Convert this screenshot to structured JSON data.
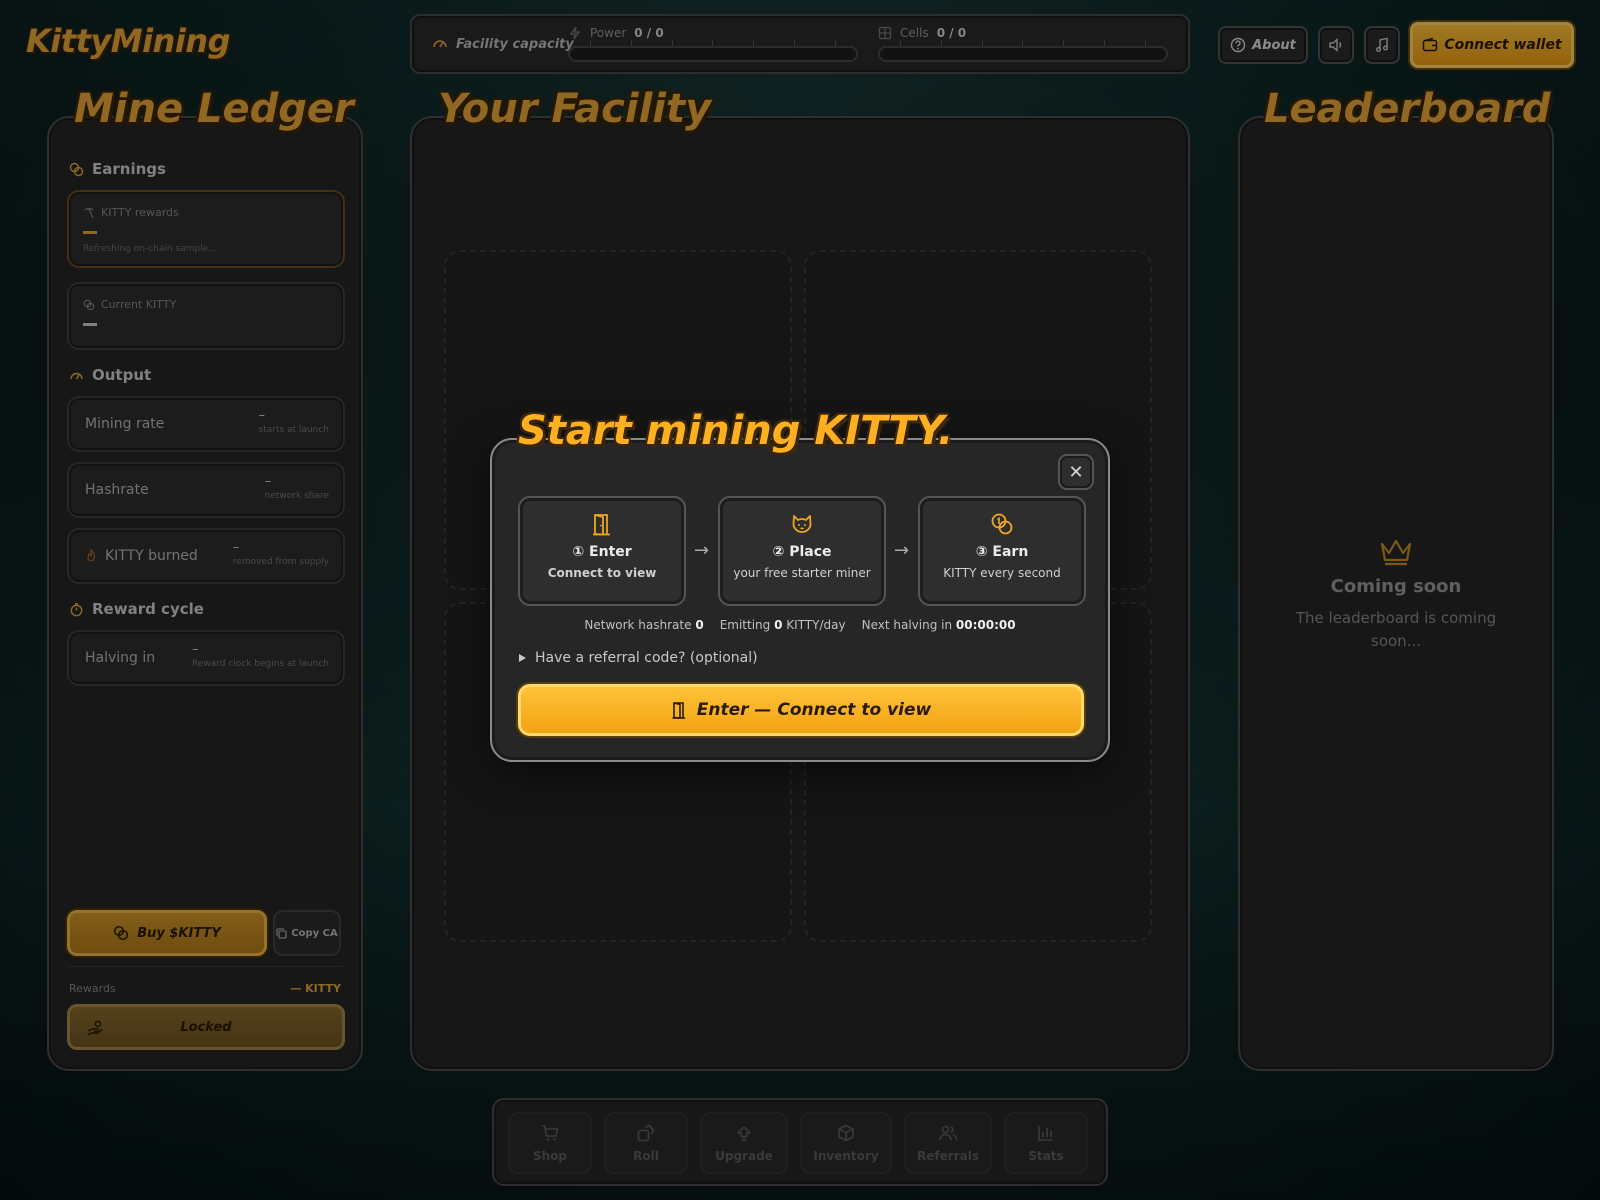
{
  "app": {
    "logo": "KittyMining"
  },
  "capacity": {
    "label": "Facility capacity",
    "power_label": "Power",
    "power_value": "0 / 0",
    "power_fraction": 0,
    "cells_label": "Cells",
    "cells_value": "0 / 0",
    "cells_fraction": 0
  },
  "header": {
    "about_label": "About",
    "connect_wallet_label": "Connect wallet"
  },
  "ledger": {
    "title": "Mine Ledger",
    "earnings_head": "Earnings",
    "kitty_rewards_label": "KITTY rewards",
    "kitty_rewards_sub": "Refreshing on-chain sample...",
    "current_kitty_label": "Current KITTY",
    "output_head": "Output",
    "mining_rate_label": "Mining rate",
    "mining_rate_value": "–",
    "mining_rate_note": "starts at launch",
    "hashrate_label": "Hashrate",
    "hashrate_value": "–",
    "hashrate_note": "network share",
    "burned_label": "KITTY burned",
    "burned_value": "–",
    "burned_note": "removed from supply",
    "reward_cycle_head": "Reward cycle",
    "halving_label": "Halving in",
    "halving_value": "–",
    "halving_note": "Reward clock begins at launch",
    "buy_label": "Buy $KITTY",
    "copy_label": "Copy CA",
    "rewards_label": "Rewards",
    "rewards_value": "— KITTY",
    "locked_label": "Locked"
  },
  "facility": {
    "title": "Your Facility"
  },
  "leaderboard": {
    "title": "Leaderboard",
    "soon_title": "Coming soon",
    "soon_text": "The leaderboard is coming soon..."
  },
  "modal": {
    "title": "Start mining KITTY.",
    "close_label": "✕",
    "steps": [
      {
        "heading": "① Enter",
        "desc": "Connect to view"
      },
      {
        "heading": "② Place",
        "desc": "your free starter miner"
      },
      {
        "heading": "③ Earn",
        "desc": "KITTY every second"
      }
    ],
    "network_hashrate_label": "Network hashrate",
    "network_hashrate_value": "0",
    "emitting_label": "Emitting",
    "emitting_value": "0",
    "emitting_unit": "KITTY/day",
    "halving_label": "Next halving in",
    "halving_value": "00:00:00",
    "referral_label": "Have a referral code? (optional)",
    "enter_label": "Enter — Connect to view"
  },
  "nav": {
    "items": [
      {
        "label": "Shop",
        "icon": "cart-icon"
      },
      {
        "label": "Roll",
        "icon": "dice-icon"
      },
      {
        "label": "Upgrade",
        "icon": "upgrade-icon"
      },
      {
        "label": "Inventory",
        "icon": "box-icon"
      },
      {
        "label": "Referrals",
        "icon": "users-icon"
      },
      {
        "label": "Stats",
        "icon": "bar-chart-icon"
      }
    ]
  },
  "colors": {
    "accent": "#ffb020",
    "panel": "#262626",
    "background": "#143130"
  }
}
